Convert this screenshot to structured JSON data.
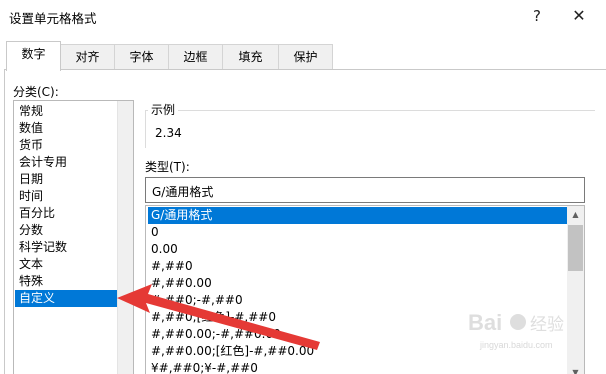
{
  "dialog": {
    "title": "设置单元格格式",
    "help_label": "?",
    "close_label": "✕"
  },
  "tabs": [
    {
      "label": "数字",
      "active": true
    },
    {
      "label": "对齐",
      "active": false
    },
    {
      "label": "字体",
      "active": false
    },
    {
      "label": "边框",
      "active": false
    },
    {
      "label": "填充",
      "active": false
    },
    {
      "label": "保护",
      "active": false
    }
  ],
  "category": {
    "label": "分类(C):",
    "items": [
      "常规",
      "数值",
      "货币",
      "会计专用",
      "日期",
      "时间",
      "百分比",
      "分数",
      "科学记数",
      "文本",
      "特殊",
      "自定义"
    ],
    "selected_index": 11
  },
  "sample": {
    "label": "示例",
    "value": "2.34"
  },
  "type": {
    "label": "类型(T):",
    "input_value": "G/通用格式",
    "formats": [
      "G/通用格式",
      "0",
      "0.00",
      "#,##0",
      "#,##0.00",
      "#,##0;-#,##0",
      "#,##0;[红色]-#,##0",
      "#,##0.00;-#,##0.00",
      "#,##0.00;[红色]-#,##0.00",
      "¥#,##0;¥-#,##0"
    ],
    "selected_index": 0
  },
  "watermark": {
    "brand": "Baidu经验",
    "url": "jingyan.baidu.com"
  },
  "colors": {
    "selection": "#0078d7",
    "annotation_arrow": "#e53935"
  }
}
